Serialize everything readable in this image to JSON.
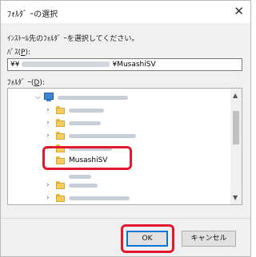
{
  "window": {
    "title": "ﾌｫﾙﾀﾞ ｰの選択",
    "close_glyph": "✕"
  },
  "instruction": "ｲﾝｽﾄｰﾙ先のﾌｫﾙﾀﾞ ｰを選択してください。",
  "path": {
    "label": "ﾊﾟｽ(",
    "access_key": "P",
    "label_suffix": "):",
    "value_prefix": "¥¥",
    "value_suffix": "¥MusashiSV"
  },
  "folder": {
    "label": "ﾌｫﾙﾀﾞ ｰ(",
    "access_key": "D",
    "label_suffix": "):"
  },
  "tree": {
    "selected_label": "MusashiSV",
    "scrollbar": {
      "up": "▲",
      "down": "▼"
    }
  },
  "buttons": {
    "ok": "OK",
    "cancel": "キャンセル"
  },
  "colors": {
    "highlight": "#e0192e",
    "folder": "#f6cd5a",
    "accent": "#0078d7"
  }
}
